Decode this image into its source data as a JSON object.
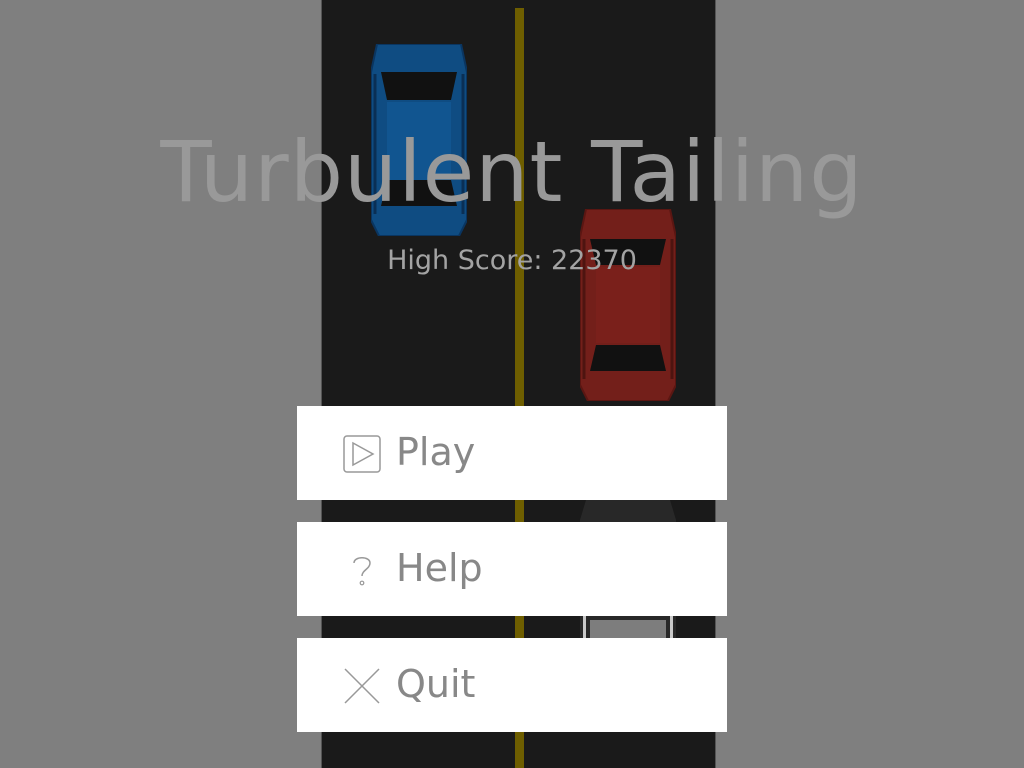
{
  "game": {
    "title": "Turbulent Tailing",
    "high_score_text": "High Score: 22370"
  },
  "menu": {
    "items": [
      {
        "label": "Play",
        "icon": "play-icon"
      },
      {
        "label": "Help",
        "icon": "question-icon"
      },
      {
        "label": "Quit",
        "icon": "close-icon"
      }
    ]
  },
  "colors": {
    "background": "#7f7f7f",
    "road": "#1a1a1a",
    "center_line": "#6e5e00",
    "car_blue": "#0f4c82",
    "car_red": "#731f1a",
    "text_gray": "#999999",
    "button_bg": "#ffffff"
  }
}
